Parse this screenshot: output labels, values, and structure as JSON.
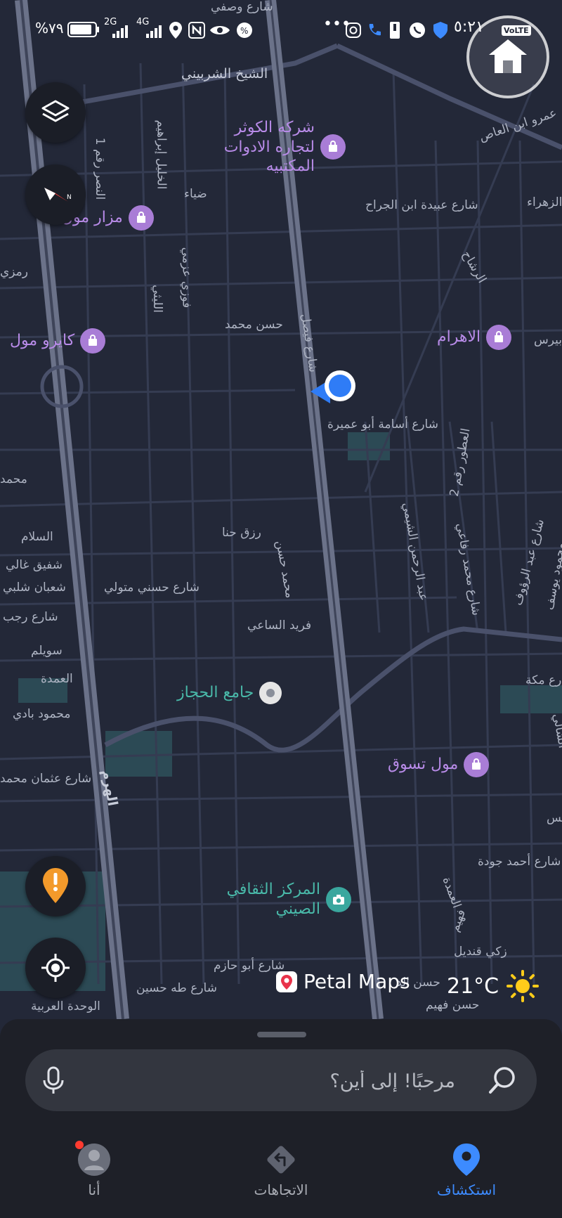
{
  "status_bar": {
    "battery_percent": "%٧٩",
    "signal_2g": "2G",
    "signal_4g": "4G",
    "time": "٥:٢١",
    "volte": "VoLTE"
  },
  "map": {
    "street_labels": [
      "شارع وصفي",
      "الشيخ الشربيني",
      "الخليل إبراهيم",
      "النصر رقم 1",
      "ضياء",
      "فوزي عزمي",
      "الليثي",
      "رمزي",
      "حسن محمد",
      "شارع فيصل",
      "شارع عبيدة ابن الجراح",
      "عمرو ابن العاص",
      "الزهراء",
      "الرشاح",
      "بيرس",
      "شارع أسامة أبو عميرة",
      "العطور رقم 2",
      "عبد الرحمن الشيمي",
      "شارع محمد رفاعي",
      "شارع عبد الرؤوف",
      "محمود يوسف",
      "محمد",
      "السلام",
      "شفيق غالي",
      "شعبان شلبي",
      "شارع رجب",
      "سويلم",
      "العمدة",
      "محمود بادي",
      "شارع عثمان محمد",
      "رزق حنا",
      "محمد حسن",
      "شارع حسني متولي",
      "فريد الساعي",
      "الهرم",
      "شارع مكة",
      "الشالي",
      "شارع أحمد جودة",
      "العمدة",
      "فهيم",
      "زكي قنديل",
      "حسن الد",
      "حسن فهيم",
      "شارع أبو حازم",
      "شارع طه حسين",
      "الوحدة العربية",
      "مس"
    ],
    "pois": {
      "kawthar": "شركه الكوثر لتجاره الادوات المكتبيه",
      "mazar_mall": "مزار مول",
      "cairo_mall": "كايرو مول",
      "ahram": "الاهرام",
      "hegaz_mosque": "جامع الحجاز",
      "tasawoq_mall": "مول تسوق",
      "chinese_center": "المركز الثقافي الصيني"
    },
    "brand": "Petal Maps",
    "temperature": "21°C"
  },
  "search": {
    "placeholder": "مرحبًا! إلى أين؟"
  },
  "bottom_nav": {
    "explore": "استكشاف",
    "directions": "الاتجاهات",
    "me": "أنا"
  },
  "colors": {
    "map_bg": "#232838",
    "road": "#3f4660",
    "highway": "#6b7289",
    "poi_purple": "#a97dd6",
    "location_blue": "#2f7cf6",
    "accent": "#3d8bff",
    "warning_orange": "#f39a2b"
  },
  "icons": [
    "layers-icon",
    "compass-icon",
    "home-search-icon",
    "report-icon",
    "locate-icon",
    "mic-icon",
    "search-icon",
    "explore-pin-icon",
    "directions-icon",
    "profile-icon",
    "sun-icon",
    "petal-maps-logo"
  ]
}
